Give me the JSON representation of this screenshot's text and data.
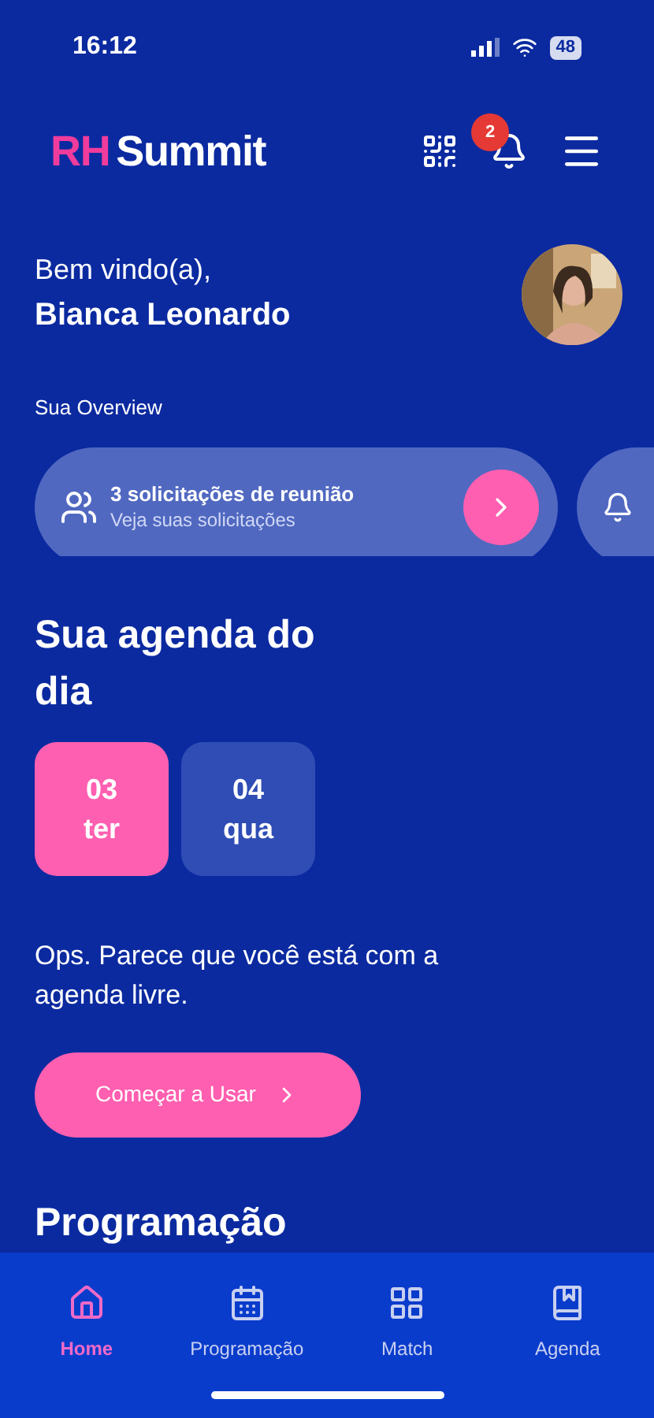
{
  "status_bar": {
    "time": "16:12",
    "battery": "48"
  },
  "header": {
    "logo_accent": "RH",
    "logo_name": "Summit",
    "notification_count": "2"
  },
  "greeting": {
    "line": "Bem vindo(a),",
    "name": "Bianca Leonardo"
  },
  "overview": {
    "label": "Sua Overview",
    "cards": [
      {
        "kind": "requests",
        "title": "3 solicitações de reunião",
        "subtitle": "Veja suas solicitações"
      },
      {
        "kind": "notifications"
      }
    ]
  },
  "agenda": {
    "title": "Sua agenda do dia",
    "days": [
      {
        "number": "03",
        "weekday": "ter",
        "selected": true
      },
      {
        "number": "04",
        "weekday": "qua",
        "selected": false
      }
    ],
    "empty_message": "Ops. Parece que você está com a agenda livre.",
    "cta": "Começar a Usar"
  },
  "section_title": "Programação",
  "bottom_nav": [
    {
      "kind": "home",
      "label": "Home",
      "selected": true
    },
    {
      "kind": "calendar",
      "label": "Programação",
      "selected": false
    },
    {
      "kind": "match",
      "label": "Match",
      "selected": false
    },
    {
      "kind": "book",
      "label": "Agenda",
      "selected": false
    }
  ]
}
